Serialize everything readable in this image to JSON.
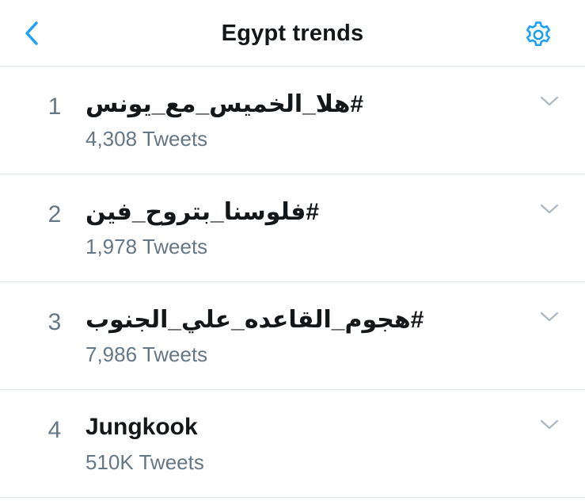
{
  "header": {
    "title": "Egypt trends",
    "back_icon": "chevron-left-icon",
    "settings_icon": "gear-icon",
    "accent_color": "#1da1f2"
  },
  "trends": [
    {
      "rank": "1",
      "name": "#هلا_الخميس_مع_يونس",
      "count": "4,308 Tweets"
    },
    {
      "rank": "2",
      "name": "#فلوسنا_بتروح_فين",
      "count": "1,978 Tweets"
    },
    {
      "rank": "3",
      "name": "#هجوم_القاعده_علي_الجنوب",
      "count": "7,986 Tweets"
    },
    {
      "rank": "4",
      "name": "Jungkook",
      "count": "510K Tweets"
    }
  ],
  "colors": {
    "text_primary": "#14171a",
    "text_secondary": "#657786",
    "divider": "#e1e8ed",
    "chevron": "#aab8c2"
  }
}
